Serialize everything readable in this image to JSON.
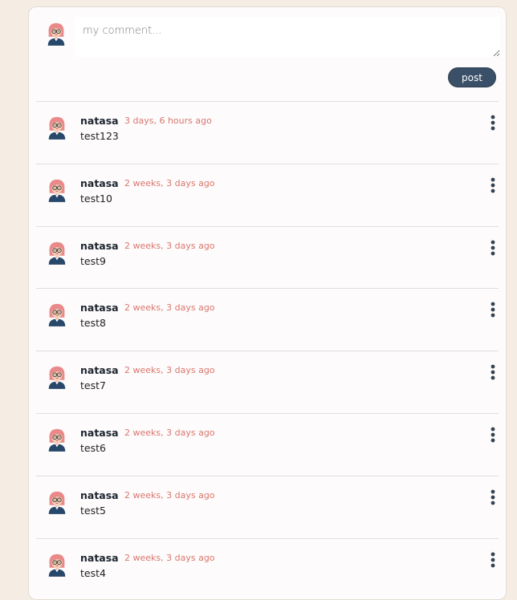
{
  "composer": {
    "placeholder": "my comment...",
    "post_label": "post"
  },
  "colors": {
    "page_background": "#f5ede3",
    "card_background": "#fdfbfb",
    "post_button": "#3a5068",
    "timestamp": "#d9776f"
  },
  "icons": {
    "avatar": "avatar-icon",
    "menu": "kebab-menu-icon"
  },
  "comments": [
    {
      "author": "natasa",
      "time": "3 days, 6 hours ago",
      "text": "test123"
    },
    {
      "author": "natasa",
      "time": "2 weeks, 3 days ago",
      "text": "test10"
    },
    {
      "author": "natasa",
      "time": "2 weeks, 3 days ago",
      "text": "test9"
    },
    {
      "author": "natasa",
      "time": "2 weeks, 3 days ago",
      "text": "test8"
    },
    {
      "author": "natasa",
      "time": "2 weeks, 3 days ago",
      "text": "test7"
    },
    {
      "author": "natasa",
      "time": "2 weeks, 3 days ago",
      "text": "test6"
    },
    {
      "author": "natasa",
      "time": "2 weeks, 3 days ago",
      "text": "test5"
    },
    {
      "author": "natasa",
      "time": "2 weeks, 3 days ago",
      "text": "test4"
    }
  ]
}
